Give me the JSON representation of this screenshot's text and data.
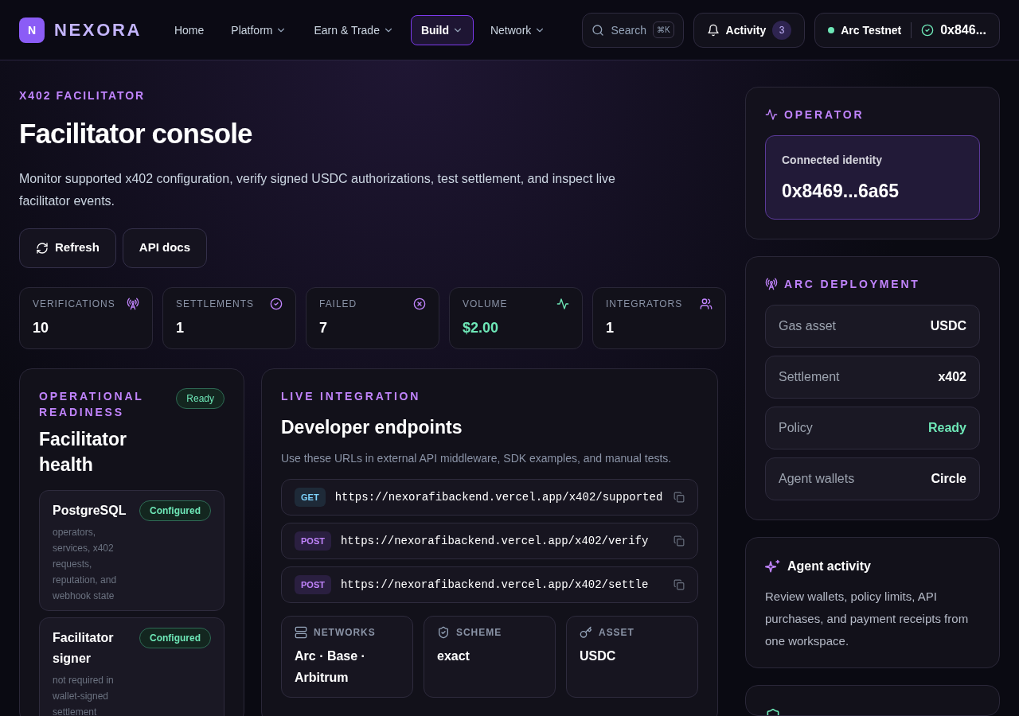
{
  "header": {
    "logo_letter": "N",
    "brand": "NEXORA",
    "nav": [
      {
        "label": "Home",
        "selected": false,
        "dropdown": false
      },
      {
        "label": "Platform",
        "selected": false,
        "dropdown": true
      },
      {
        "label": "Earn & Trade",
        "selected": false,
        "dropdown": true
      },
      {
        "label": "Build",
        "selected": true,
        "dropdown": true
      },
      {
        "label": "Network",
        "selected": false,
        "dropdown": true
      }
    ],
    "search": {
      "placeholder": "Search",
      "shortcut": "⌘K"
    },
    "activity": {
      "label": "Activity",
      "count": "3"
    },
    "network": {
      "name": "Arc Testnet",
      "address": "0x846..."
    }
  },
  "hero": {
    "eyebrow": "X402 FACILITATOR",
    "title": "Facilitator console",
    "description": "Monitor supported x402 configuration, verify signed USDC authorizations, test settlement, and inspect live facilitator events.",
    "buttons": [
      {
        "label": "Refresh",
        "kind": "refresh"
      },
      {
        "label": "API docs",
        "kind": "plain"
      }
    ]
  },
  "stats": [
    {
      "label": "VERIFICATIONS",
      "value": "10",
      "kind": "antenna",
      "highlight": false
    },
    {
      "label": "SETTLEMENTS",
      "value": "1",
      "kind": "check",
      "highlight": false
    },
    {
      "label": "FAILED",
      "value": "7",
      "kind": "x",
      "highlight": false
    },
    {
      "label": "VOLUME",
      "value": "$2.00",
      "kind": "pulse",
      "highlight": true
    },
    {
      "label": "INTEGRATORS",
      "value": "1",
      "kind": "users",
      "highlight": false
    }
  ],
  "health": {
    "eyebrow": "OPERATIONAL READINESS",
    "badge": "Ready",
    "title": "Facilitator health",
    "items": [
      {
        "name": "PostgreSQL",
        "badge": "Configured",
        "description": "operators, services, x402 requests, reputation, and webhook state"
      },
      {
        "name": "Facilitator signer",
        "badge": "Configured",
        "description": "not required in wallet-signed settlement"
      }
    ]
  },
  "integration": {
    "eyebrow": "LIVE INTEGRATION",
    "title": "Developer endpoints",
    "description": "Use these URLs in external API middleware, SDK examples, and manual tests.",
    "endpoints": [
      {
        "method": "GET",
        "kind": "get",
        "url": "https://nexorafibackend.vercel.app/x402/supported"
      },
      {
        "method": "POST",
        "kind": "post",
        "url": "https://nexorafibackend.vercel.app/x402/verify"
      },
      {
        "method": "POST",
        "kind": "post",
        "url": "https://nexorafibackend.vercel.app/x402/settle"
      }
    ],
    "facts": [
      {
        "label": "NETWORKS",
        "value": "Arc · Base · Arbitrum",
        "kind": "server"
      },
      {
        "label": "SCHEME",
        "value": "exact",
        "kind": "shield"
      },
      {
        "label": "ASSET",
        "value": "USDC",
        "kind": "key"
      }
    ]
  },
  "operator": {
    "eyebrow": "OPERATOR",
    "identity_label": "Connected identity",
    "identity": "0x8469...6a65"
  },
  "deployment": {
    "eyebrow": "ARC DEPLOYMENT",
    "rows": [
      {
        "label": "Gas asset",
        "value": "USDC",
        "highlight": false
      },
      {
        "label": "Settlement",
        "value": "x402",
        "highlight": false
      },
      {
        "label": "Policy",
        "value": "Ready",
        "highlight": true
      },
      {
        "label": "Agent wallets",
        "value": "Circle",
        "highlight": false
      }
    ]
  },
  "agent": {
    "title": "Agent activity",
    "description": "Review wallets, policy limits, API purchases, and payment receipts from one workspace."
  }
}
